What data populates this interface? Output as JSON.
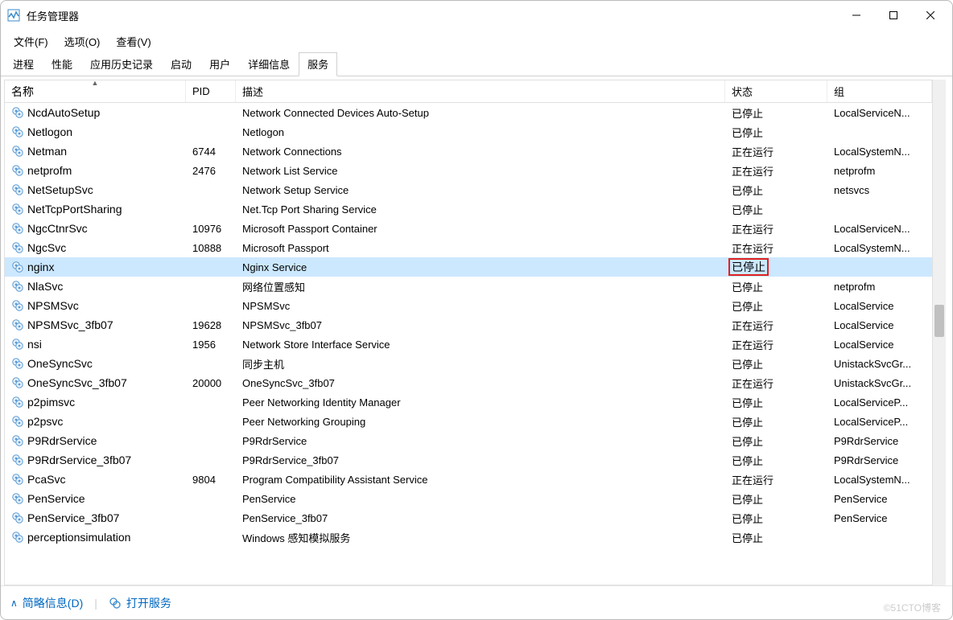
{
  "window": {
    "title": "任务管理器"
  },
  "menubar": [
    "文件(F)",
    "选项(O)",
    "查看(V)"
  ],
  "tabs": {
    "items": [
      "进程",
      "性能",
      "应用历史记录",
      "启动",
      "用户",
      "详细信息",
      "服务"
    ],
    "active": 6
  },
  "columns": {
    "name": "名称",
    "pid": "PID",
    "desc": "描述",
    "status": "状态",
    "group": "组"
  },
  "services": [
    {
      "name": "NcdAutoSetup",
      "pid": "",
      "desc": "Network Connected Devices Auto-Setup",
      "status": "已停止",
      "group": "LocalServiceN..."
    },
    {
      "name": "Netlogon",
      "pid": "",
      "desc": "Netlogon",
      "status": "已停止",
      "group": ""
    },
    {
      "name": "Netman",
      "pid": "6744",
      "desc": "Network Connections",
      "status": "正在运行",
      "group": "LocalSystemN..."
    },
    {
      "name": "netprofm",
      "pid": "2476",
      "desc": "Network List Service",
      "status": "正在运行",
      "group": "netprofm"
    },
    {
      "name": "NetSetupSvc",
      "pid": "",
      "desc": "Network Setup Service",
      "status": "已停止",
      "group": "netsvcs"
    },
    {
      "name": "NetTcpPortSharing",
      "pid": "",
      "desc": "Net.Tcp Port Sharing Service",
      "status": "已停止",
      "group": ""
    },
    {
      "name": "NgcCtnrSvc",
      "pid": "10976",
      "desc": "Microsoft Passport Container",
      "status": "正在运行",
      "group": "LocalServiceN..."
    },
    {
      "name": "NgcSvc",
      "pid": "10888",
      "desc": "Microsoft Passport",
      "status": "正在运行",
      "group": "LocalSystemN..."
    },
    {
      "name": "nginx",
      "pid": "",
      "desc": "Nginx Service",
      "status": "已停止",
      "group": "",
      "selected": true,
      "highlight": true
    },
    {
      "name": "NlaSvc",
      "pid": "",
      "desc": "网络位置感知",
      "status": "已停止",
      "group": "netprofm"
    },
    {
      "name": "NPSMSvc",
      "pid": "",
      "desc": "NPSMSvc",
      "status": "已停止",
      "group": "LocalService"
    },
    {
      "name": "NPSMSvc_3fb07",
      "pid": "19628",
      "desc": "NPSMSvc_3fb07",
      "status": "正在运行",
      "group": "LocalService"
    },
    {
      "name": "nsi",
      "pid": "1956",
      "desc": "Network Store Interface Service",
      "status": "正在运行",
      "group": "LocalService"
    },
    {
      "name": "OneSyncSvc",
      "pid": "",
      "desc": "同步主机",
      "status": "已停止",
      "group": "UnistackSvcGr..."
    },
    {
      "name": "OneSyncSvc_3fb07",
      "pid": "20000",
      "desc": "OneSyncSvc_3fb07",
      "status": "正在运行",
      "group": "UnistackSvcGr..."
    },
    {
      "name": "p2pimsvc",
      "pid": "",
      "desc": "Peer Networking Identity Manager",
      "status": "已停止",
      "group": "LocalServiceP..."
    },
    {
      "name": "p2psvc",
      "pid": "",
      "desc": "Peer Networking Grouping",
      "status": "已停止",
      "group": "LocalServiceP..."
    },
    {
      "name": "P9RdrService",
      "pid": "",
      "desc": "P9RdrService",
      "status": "已停止",
      "group": "P9RdrService"
    },
    {
      "name": "P9RdrService_3fb07",
      "pid": "",
      "desc": "P9RdrService_3fb07",
      "status": "已停止",
      "group": "P9RdrService"
    },
    {
      "name": "PcaSvc",
      "pid": "9804",
      "desc": "Program Compatibility Assistant Service",
      "status": "正在运行",
      "group": "LocalSystemN..."
    },
    {
      "name": "PenService",
      "pid": "",
      "desc": "PenService",
      "status": "已停止",
      "group": "PenService"
    },
    {
      "name": "PenService_3fb07",
      "pid": "",
      "desc": "PenService_3fb07",
      "status": "已停止",
      "group": "PenService"
    },
    {
      "name": "perceptionsimulation",
      "pid": "",
      "desc": "Windows 感知模拟服务",
      "status": "已停止",
      "group": ""
    }
  ],
  "footer": {
    "brief": "简略信息(D)",
    "open": "打开服务"
  },
  "watermark": "©51CTO博客"
}
